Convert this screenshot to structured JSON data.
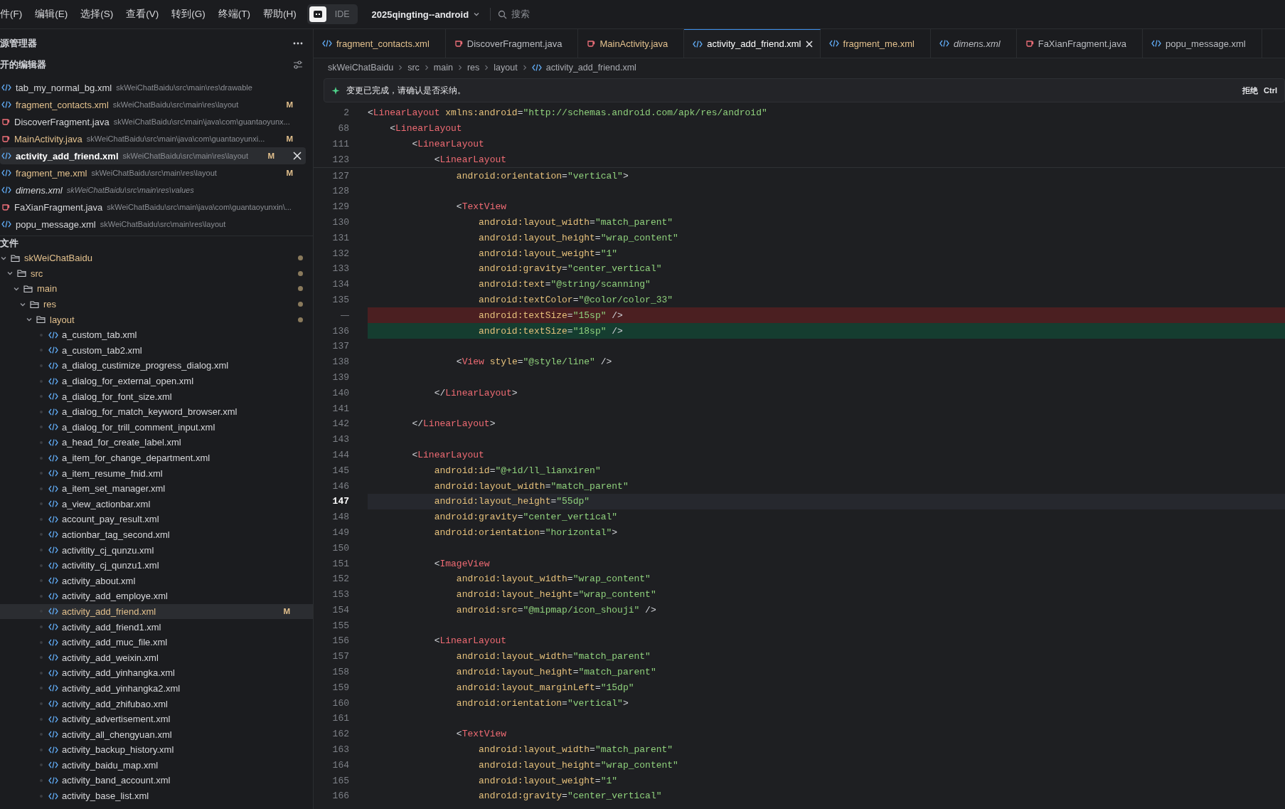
{
  "menu": [
    "件(F)",
    "编辑(E)",
    "选择(S)",
    "查看(V)",
    "转到(G)",
    "终端(T)",
    "帮助(H)"
  ],
  "mode_toggle": {
    "label": "IDE"
  },
  "project": {
    "name": "2025qingting--android"
  },
  "search": {
    "placeholder": "搜索"
  },
  "sidebar": {
    "title": "源管理器",
    "open_editors": {
      "title": "开的编辑器",
      "items": [
        {
          "name": "tab_my_normal_bg.xml",
          "path": "skWeiChatBaidu\\src\\main\\res\\drawable",
          "kind": "xml",
          "modified": false,
          "preview": false,
          "selected": false
        },
        {
          "name": "fragment_contacts.xml",
          "path": "skWeiChatBaidu\\src\\main\\res\\layout",
          "kind": "xml",
          "modified": true,
          "badge": "M",
          "preview": false,
          "selected": false
        },
        {
          "name": "DiscoverFragment.java",
          "path": "skWeiChatBaidu\\src\\main\\java\\com\\guantaoyunx...",
          "kind": "java",
          "modified": false,
          "preview": false,
          "selected": false
        },
        {
          "name": "MainActivity.java",
          "path": "skWeiChatBaidu\\src\\main\\java\\com\\guantaoyunxi...",
          "kind": "java",
          "modified": true,
          "badge": "M",
          "preview": false,
          "selected": false
        },
        {
          "name": "activity_add_friend.xml",
          "path": "skWeiChatBaidu\\src\\main\\res\\layout",
          "kind": "xml",
          "modified": true,
          "badge": "M",
          "preview": false,
          "selected": true
        },
        {
          "name": "fragment_me.xml",
          "path": "skWeiChatBaidu\\src\\main\\res\\layout",
          "kind": "xml",
          "modified": true,
          "badge": "M",
          "preview": false,
          "selected": false
        },
        {
          "name": "dimens.xml",
          "path": "skWeiChatBaidu\\src\\main\\res\\values",
          "kind": "xml",
          "modified": false,
          "preview": true,
          "selected": false
        },
        {
          "name": "FaXianFragment.java",
          "path": "skWeiChatBaidu\\src\\main\\java\\com\\guantaoyunxin\\...",
          "kind": "java",
          "modified": false,
          "preview": false,
          "selected": false
        },
        {
          "name": "popu_message.xml",
          "path": "skWeiChatBaidu\\src\\main\\res\\layout",
          "kind": "xml",
          "modified": false,
          "preview": false,
          "selected": false
        }
      ]
    },
    "files": {
      "title": "文件",
      "tree": [
        {
          "label": "skWeiChatBaidu",
          "kind": "folder",
          "expanded": true,
          "modified": true,
          "selected": false,
          "children": [
            {
              "label": "src",
              "kind": "folder",
              "expanded": true,
              "modified": true,
              "selected": false,
              "children": [
                {
                  "label": "main",
                  "kind": "folder",
                  "expanded": true,
                  "modified": true,
                  "selected": false,
                  "children": [
                    {
                      "label": "res",
                      "kind": "folder",
                      "expanded": true,
                      "modified": true,
                      "selected": false,
                      "children": [
                        {
                          "label": "layout",
                          "kind": "folder",
                          "expanded": true,
                          "modified": true,
                          "selected": false,
                          "children": [
                            {
                              "label": "a_custom_tab.xml",
                              "kind": "xml",
                              "modified": false,
                              "selected": false
                            },
                            {
                              "label": "a_custom_tab2.xml",
                              "kind": "xml",
                              "modified": false,
                              "selected": false
                            },
                            {
                              "label": "a_dialog_custimize_progress_dialog.xml",
                              "kind": "xml",
                              "modified": false,
                              "selected": false
                            },
                            {
                              "label": "a_dialog_for_external_open.xml",
                              "kind": "xml",
                              "modified": false,
                              "selected": false
                            },
                            {
                              "label": "a_dialog_for_font_size.xml",
                              "kind": "xml",
                              "modified": false,
                              "selected": false
                            },
                            {
                              "label": "a_dialog_for_match_keyword_browser.xml",
                              "kind": "xml",
                              "modified": false,
                              "selected": false
                            },
                            {
                              "label": "a_dialog_for_trill_comment_input.xml",
                              "kind": "xml",
                              "modified": false,
                              "selected": false
                            },
                            {
                              "label": "a_head_for_create_label.xml",
                              "kind": "xml",
                              "modified": false,
                              "selected": false
                            },
                            {
                              "label": "a_item_for_change_department.xml",
                              "kind": "xml",
                              "modified": false,
                              "selected": false
                            },
                            {
                              "label": "a_item_resume_fnid.xml",
                              "kind": "xml",
                              "modified": false,
                              "selected": false
                            },
                            {
                              "label": "a_item_set_manager.xml",
                              "kind": "xml",
                              "modified": false,
                              "selected": false
                            },
                            {
                              "label": "a_view_actionbar.xml",
                              "kind": "xml",
                              "modified": false,
                              "selected": false
                            },
                            {
                              "label": "account_pay_result.xml",
                              "kind": "xml",
                              "modified": false,
                              "selected": false
                            },
                            {
                              "label": "actionbar_tag_second.xml",
                              "kind": "xml",
                              "modified": false,
                              "selected": false
                            },
                            {
                              "label": "activitity_cj_qunzu.xml",
                              "kind": "xml",
                              "modified": false,
                              "selected": false
                            },
                            {
                              "label": "activitity_cj_qunzu1.xml",
                              "kind": "xml",
                              "modified": false,
                              "selected": false
                            },
                            {
                              "label": "activity_about.xml",
                              "kind": "xml",
                              "modified": false,
                              "selected": false
                            },
                            {
                              "label": "activity_add_employe.xml",
                              "kind": "xml",
                              "modified": false,
                              "selected": false
                            },
                            {
                              "label": "activity_add_friend.xml",
                              "kind": "xml",
                              "modified": true,
                              "badge": "M",
                              "selected": true
                            },
                            {
                              "label": "activity_add_friend1.xml",
                              "kind": "xml",
                              "modified": false,
                              "selected": false
                            },
                            {
                              "label": "activity_add_muc_file.xml",
                              "kind": "xml",
                              "modified": false,
                              "selected": false
                            },
                            {
                              "label": "activity_add_weixin.xml",
                              "kind": "xml",
                              "modified": false,
                              "selected": false
                            },
                            {
                              "label": "activity_add_yinhangka.xml",
                              "kind": "xml",
                              "modified": false,
                              "selected": false
                            },
                            {
                              "label": "activity_add_yinhangka2.xml",
                              "kind": "xml",
                              "modified": false,
                              "selected": false
                            },
                            {
                              "label": "activity_add_zhifubao.xml",
                              "kind": "xml",
                              "modified": false,
                              "selected": false
                            },
                            {
                              "label": "activity_advertisement.xml",
                              "kind": "xml",
                              "modified": false,
                              "selected": false
                            },
                            {
                              "label": "activity_all_chengyuan.xml",
                              "kind": "xml",
                              "modified": false,
                              "selected": false
                            },
                            {
                              "label": "activity_backup_history.xml",
                              "kind": "xml",
                              "modified": false,
                              "selected": false
                            },
                            {
                              "label": "activity_baidu_map.xml",
                              "kind": "xml",
                              "modified": false,
                              "selected": false
                            },
                            {
                              "label": "activity_band_account.xml",
                              "kind": "xml",
                              "modified": false,
                              "selected": false
                            },
                            {
                              "label": "activity_base_list.xml",
                              "kind": "xml",
                              "modified": false,
                              "selected": false
                            }
                          ]
                        }
                      ]
                    }
                  ]
                }
              ]
            }
          ]
        }
      ]
    }
  },
  "tabs": [
    {
      "label": "fragment_contacts.xml",
      "kind": "xml",
      "modified": true,
      "preview": false,
      "selected": false
    },
    {
      "label": "DiscoverFragment.java",
      "kind": "java",
      "modified": false,
      "preview": false,
      "selected": false
    },
    {
      "label": "MainActivity.java",
      "kind": "java",
      "modified": true,
      "preview": false,
      "selected": false
    },
    {
      "label": "activity_add_friend.xml",
      "kind": "xml",
      "modified": false,
      "preview": false,
      "selected": true
    },
    {
      "label": "fragment_me.xml",
      "kind": "xml",
      "modified": true,
      "preview": false,
      "selected": false
    },
    {
      "label": "dimens.xml",
      "kind": "xml",
      "modified": false,
      "preview": true,
      "selected": false
    },
    {
      "label": "FaXianFragment.java",
      "kind": "java",
      "modified": false,
      "preview": false,
      "selected": false
    },
    {
      "label": "popu_message.xml",
      "kind": "xml",
      "modified": false,
      "preview": false,
      "selected": false
    }
  ],
  "breadcrumbs": [
    {
      "label": "skWeiChatBaidu",
      "kind": "folder"
    },
    {
      "label": "src",
      "kind": "folder"
    },
    {
      "label": "main",
      "kind": "folder"
    },
    {
      "label": "res",
      "kind": "folder"
    },
    {
      "label": "layout",
      "kind": "folder"
    },
    {
      "label": "activity_add_friend.xml",
      "kind": "xml"
    }
  ],
  "notice": {
    "message": "变更已完成，请确认是否采纳。",
    "reject": "拒绝",
    "shortcut": "Ctrl"
  },
  "sticky_lines": [
    {
      "number": "2",
      "text": "<LinearLayout xmlns:android=\"http://schemas.android.com/apk/res/android\""
    },
    {
      "number": "68",
      "text": "    <LinearLayout"
    },
    {
      "number": "111",
      "text": "        <LinearLayout"
    },
    {
      "number": "123",
      "text": "            <LinearLayout"
    }
  ],
  "lines": [
    {
      "number": "127",
      "kind": "normal",
      "text": "                android:orientation=\"vertical\">"
    },
    {
      "number": "128",
      "kind": "normal"
    },
    {
      "number": "129",
      "kind": "normal",
      "text": "                <TextView"
    },
    {
      "number": "130",
      "kind": "normal",
      "text": "                    android:layout_width=\"match_parent\""
    },
    {
      "number": "131",
      "kind": "normal",
      "text": "                    android:layout_height=\"wrap_content\""
    },
    {
      "number": "132",
      "kind": "normal",
      "text": "                    android:layout_weight=\"1\""
    },
    {
      "number": "133",
      "kind": "normal",
      "text": "                    android:gravity=\"center_vertical\""
    },
    {
      "number": "134",
      "kind": "normal",
      "text": "                    android:text=\"@string/scanning\""
    },
    {
      "number": "135",
      "kind": "normal",
      "text": "                    android:textColor=\"@color/color_33\""
    },
    {
      "kind": "removed",
      "text": "                    android:textSize=\"15sp\" />"
    },
    {
      "number": "136",
      "kind": "added",
      "text": "                    android:textSize=\"18sp\" />"
    },
    {
      "number": "137",
      "kind": "normal"
    },
    {
      "number": "138",
      "kind": "normal",
      "text": "                <View style=\"@style/line\" />"
    },
    {
      "number": "139",
      "kind": "normal"
    },
    {
      "number": "140",
      "kind": "normal",
      "text": "            </LinearLayout>"
    },
    {
      "number": "141",
      "kind": "normal"
    },
    {
      "number": "142",
      "kind": "normal",
      "text": "        </LinearLayout>"
    },
    {
      "number": "143",
      "kind": "normal"
    },
    {
      "number": "144",
      "kind": "normal",
      "text": "        <LinearLayout"
    },
    {
      "number": "145",
      "kind": "normal",
      "text": "            android:id=\"@+id/ll_lianxiren\""
    },
    {
      "number": "146",
      "kind": "normal",
      "text": "            android:layout_width=\"match_parent\""
    },
    {
      "number": "147",
      "kind": "current",
      "text": "            android:layout_height=\"55dp\""
    },
    {
      "number": "148",
      "kind": "normal",
      "text": "            android:gravity=\"center_vertical\""
    },
    {
      "number": "149",
      "kind": "normal",
      "text": "            android:orientation=\"horizontal\">"
    },
    {
      "number": "150",
      "kind": "normal"
    },
    {
      "number": "151",
      "kind": "normal",
      "text": "            <ImageView"
    },
    {
      "number": "152",
      "kind": "normal",
      "text": "                android:layout_width=\"wrap_content\""
    },
    {
      "number": "153",
      "kind": "normal",
      "text": "                android:layout_height=\"wrap_content\""
    },
    {
      "number": "154",
      "kind": "normal",
      "text": "                android:src=\"@mipmap/icon_shouji\" />"
    },
    {
      "number": "155",
      "kind": "normal"
    },
    {
      "number": "156",
      "kind": "normal",
      "text": "            <LinearLayout"
    },
    {
      "number": "157",
      "kind": "normal",
      "text": "                android:layout_width=\"match_parent\""
    },
    {
      "number": "158",
      "kind": "normal",
      "text": "                android:layout_height=\"match_parent\""
    },
    {
      "number": "159",
      "kind": "normal",
      "text": "                android:layout_marginLeft=\"15dp\""
    },
    {
      "number": "160",
      "kind": "normal",
      "text": "                android:orientation=\"vertical\">"
    },
    {
      "number": "161",
      "kind": "normal"
    },
    {
      "number": "162",
      "kind": "normal",
      "text": "                <TextView"
    },
    {
      "number": "163",
      "kind": "normal",
      "text": "                    android:layout_width=\"match_parent\""
    },
    {
      "number": "164",
      "kind": "normal",
      "text": "                    android:layout_height=\"wrap_content\""
    },
    {
      "number": "165",
      "kind": "normal",
      "text": "                    android:layout_weight=\"1\""
    },
    {
      "number": "166",
      "kind": "normal",
      "text": "                    android:gravity=\"center_vertical\""
    }
  ]
}
